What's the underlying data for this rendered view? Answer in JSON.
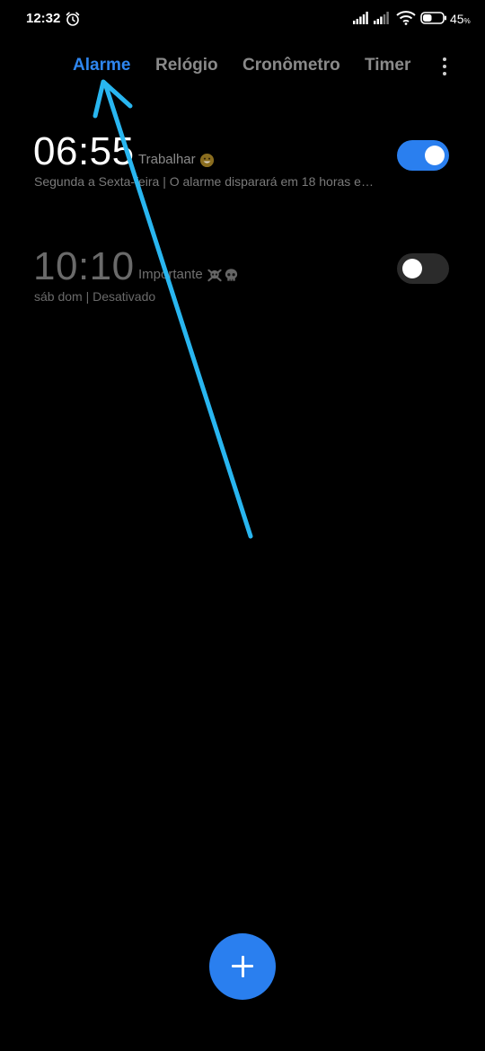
{
  "status_bar": {
    "time": "12:32",
    "battery_percent": "45",
    "battery_unit": "%",
    "battery_level": 0.45,
    "icons": [
      "alarm-clock-icon",
      "cell-signal-icon",
      "cell-signal-icon",
      "wifi-icon",
      "battery-icon"
    ]
  },
  "tabs": [
    {
      "label": "Alarme",
      "active": true
    },
    {
      "label": "Relógio",
      "active": false
    },
    {
      "label": "Cronômetro",
      "active": false
    },
    {
      "label": "Timer",
      "active": false
    }
  ],
  "more_menu_icon": "vertical-dots-icon",
  "alarms": [
    {
      "time": "06:55",
      "label": "Trabalhar",
      "label_emoji": "grinning-face-icon",
      "description": "Segunda a Sexta-feira  |  O alarme disparará em 18 horas e…",
      "enabled": true
    },
    {
      "time": "10:10",
      "label": "Importante",
      "label_emoji": "skull-crossbones-icon",
      "description": "sáb dom  |  Desativado",
      "enabled": false
    }
  ],
  "fab": {
    "icon": "plus-icon"
  },
  "colors": {
    "accent": "#2a7fef",
    "active_tab": "#2e86f0",
    "inactive_tab": "#8a8a8a",
    "background": "#000000",
    "annotation_arrow": "#29b6f0"
  }
}
